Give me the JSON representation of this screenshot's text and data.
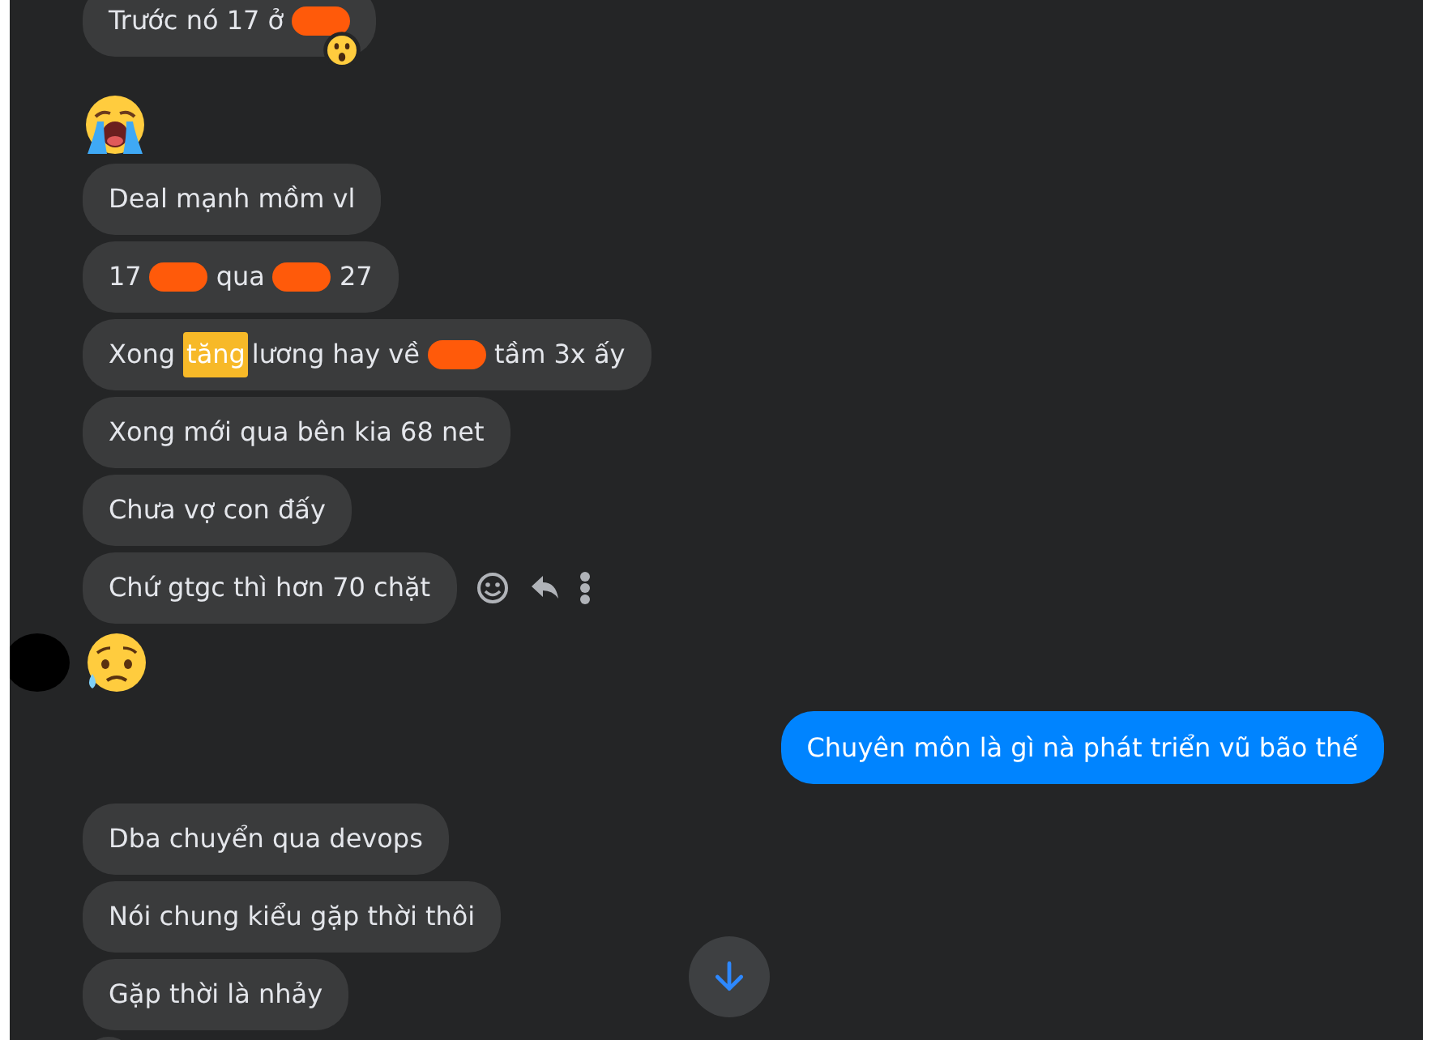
{
  "messages": [
    {
      "kind": "text",
      "outgoing": false,
      "parts": [
        {
          "kind": "text",
          "text": "Trước nó 17 ở"
        },
        {
          "kind": "redaction"
        }
      ],
      "reaction": true,
      "avatar": false,
      "hovered": false
    },
    {
      "kind": "loud-cry",
      "outgoing": false,
      "avatar": false
    },
    {
      "kind": "text",
      "outgoing": false,
      "parts": [
        {
          "kind": "text",
          "text": "Deal mạnh mồm vl"
        }
      ],
      "reaction": false,
      "avatar": false,
      "hovered": false
    },
    {
      "kind": "text",
      "outgoing": false,
      "parts": [
        {
          "kind": "text",
          "text": "17"
        },
        {
          "kind": "redaction"
        },
        {
          "kind": "text",
          "text": "qua"
        },
        {
          "kind": "redaction"
        },
        {
          "kind": "text",
          "text": "27"
        }
      ],
      "reaction": false,
      "avatar": false,
      "hovered": false
    },
    {
      "kind": "text",
      "outgoing": false,
      "parts": [
        {
          "kind": "text",
          "text": "Xong"
        },
        {
          "kind": "highlight",
          "text": "tăng"
        },
        {
          "kind": "text",
          "text": "lương hay về"
        },
        {
          "kind": "redaction"
        },
        {
          "kind": "text",
          "text": "tầm 3x ấy"
        }
      ],
      "reaction": false,
      "avatar": false,
      "hovered": false
    },
    {
      "kind": "text",
      "outgoing": false,
      "parts": [
        {
          "kind": "text",
          "text": "Xong mới qua bên kia 68 net"
        }
      ],
      "reaction": false,
      "avatar": false,
      "hovered": false
    },
    {
      "kind": "text",
      "outgoing": false,
      "parts": [
        {
          "kind": "text",
          "text": "Chưa vợ con đấy"
        }
      ],
      "reaction": false,
      "avatar": false,
      "hovered": false
    },
    {
      "kind": "text",
      "outgoing": false,
      "parts": [
        {
          "kind": "text",
          "text": "Chứ gtgc thì hơn 70 chặt"
        }
      ],
      "reaction": false,
      "avatar": false,
      "hovered": true
    },
    {
      "kind": "sad-sweat",
      "outgoing": false,
      "avatar": true
    },
    {
      "kind": "text",
      "outgoing": true,
      "parts": [
        {
          "kind": "text",
          "text": "Chuyên môn là gì nà phát triển vũ bão thế"
        }
      ],
      "reaction": false,
      "avatar": false,
      "hovered": false
    },
    {
      "kind": "text",
      "outgoing": false,
      "parts": [
        {
          "kind": "text",
          "text": "Dba chuyển qua devops"
        }
      ],
      "reaction": false,
      "avatar": false,
      "hovered": false
    },
    {
      "kind": "text",
      "outgoing": false,
      "parts": [
        {
          "kind": "text",
          "text": "Nói chung kiểu gặp thời thôi"
        }
      ],
      "reaction": false,
      "avatar": false,
      "hovered": false
    },
    {
      "kind": "text",
      "outgoing": false,
      "parts": [
        {
          "kind": "text",
          "text": "Gặp thời là nhảy"
        }
      ],
      "reaction": false,
      "avatar": false,
      "hovered": false
    },
    {
      "kind": "text",
      "outgoing": false
    }
  ],
  "scroll_down_button": true
}
